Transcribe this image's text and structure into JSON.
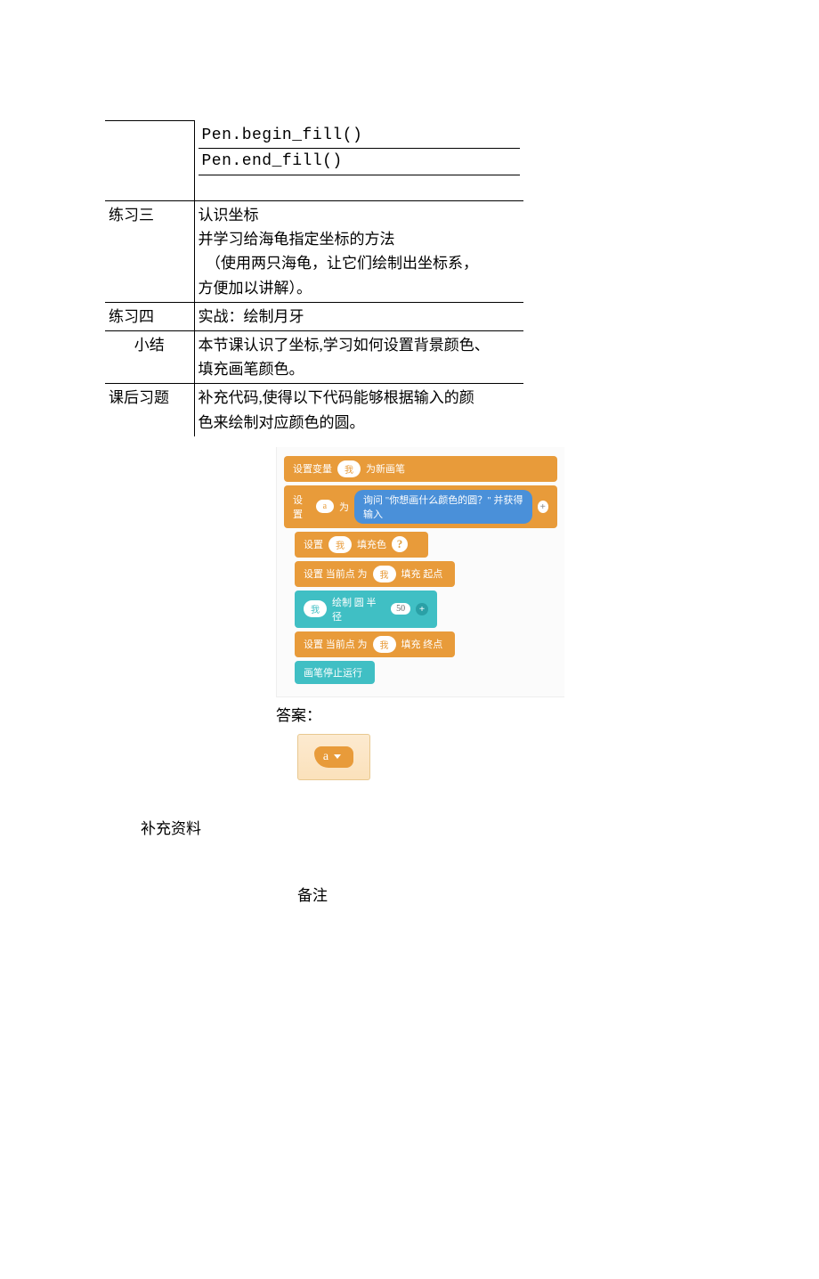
{
  "table": {
    "row0": {
      "code1": "Pen.begin_fill()",
      "code2": "Pen.end_fill()"
    },
    "row1": {
      "label": "练习三",
      "line1": "认识坐标",
      "line2": "并学习给海龟指定坐标的方法",
      "line3": "　（使用两只海龟，让它们绘制出坐标系，",
      "line4": "方便加以讲解）。"
    },
    "row2": {
      "label": "练习四",
      "text": "实战：绘制月牙"
    },
    "row3": {
      "label": "小结",
      "line1": "本节课认识了坐标,学习如何设置背景颜色、",
      "line2": "填充画笔颜色。"
    },
    "row4": {
      "label": "课后习题",
      "line1": "补充代码,使得以下代码能够根据输入的颜",
      "line2": "色来绘制对应颜色的圆。"
    }
  },
  "blocks": {
    "b1_left": "设置变量",
    "b1_pill": "我",
    "b1_right": "为新画笔",
    "b2_left": "设置",
    "b2_pill": "a",
    "b2_mid": "为",
    "b2_ask": "询问 \"你想画什么颜色的圆？\" 并获得输入",
    "b2_plus": "+",
    "b3_left": "设置",
    "b3_pill": "我",
    "b3_mid": "填充色",
    "b3_q": "?",
    "b4_left": "设置 当前点 为",
    "b4_pill": "我",
    "b4_mid": "填充 起点",
    "b5_pill": "我",
    "b5_left": "绘制 圆 半径",
    "b5_num": "50",
    "b5_plus": "+",
    "b6_left": "设置 当前点 为",
    "b6_pill": "我",
    "b6_mid": "填充 终点",
    "b7_text": "画笔停止运行"
  },
  "answer": {
    "label": "答案：",
    "value": "a"
  },
  "footer": {
    "supplement": "补充资料",
    "notes": "备注"
  }
}
